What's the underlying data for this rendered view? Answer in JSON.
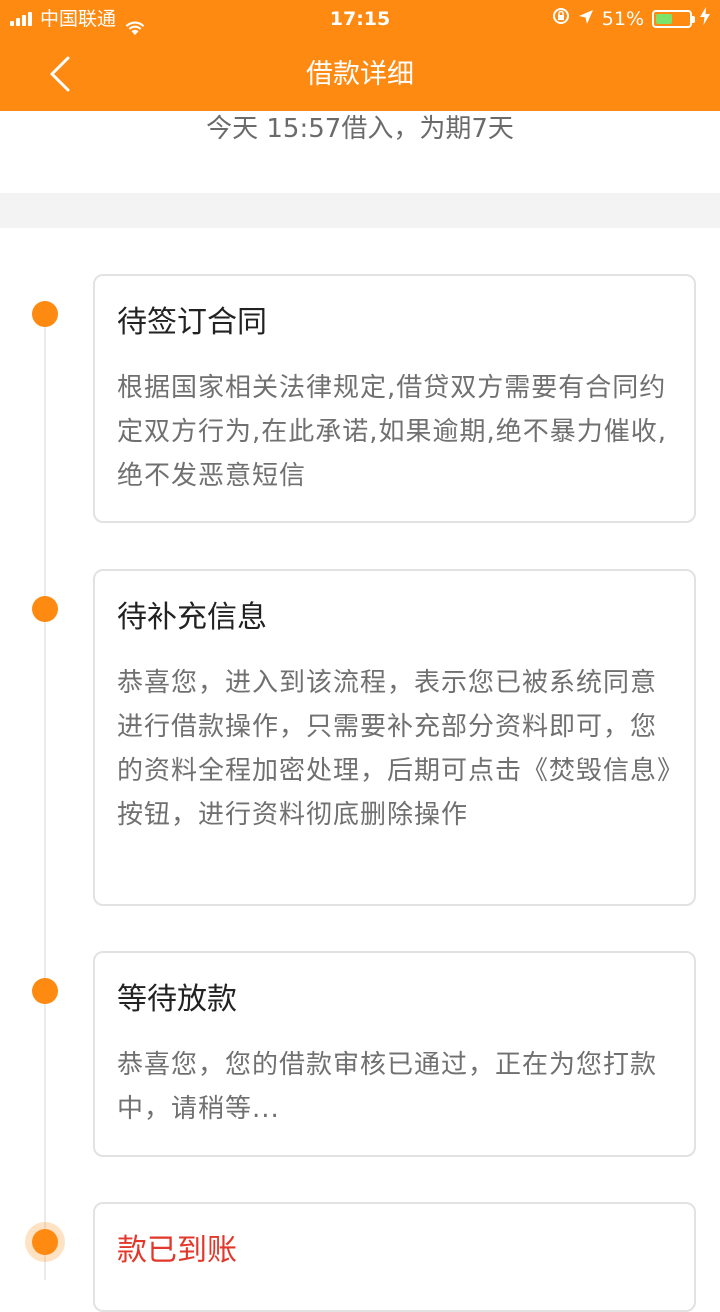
{
  "status_bar": {
    "carrier": "中国联通",
    "time": "17:15",
    "battery": "51%",
    "battery_level": 0.51
  },
  "header": {
    "title": "借款详细"
  },
  "loan": {
    "summary": "今天 15:57借入，为期7天"
  },
  "steps": [
    {
      "title": "待签订合同",
      "desc": "根据国家相关法律规定,借贷双方需要有合同约定双方行为,在此承诺,如果逾期,绝不暴力催收,绝不发恶意短信"
    },
    {
      "title": "待补充信息",
      "desc": "恭喜您，进入到该流程，表示您已被系统同意进行借款操作，只需要补充部分资料即可，您的资料全程加密处理，后期可点击《焚毁信息》按钮，进行资料彻底删除操作"
    },
    {
      "title": "等待放款",
      "desc": "恭喜您，您的借款审核已通过，正在为您打款中，请稍等..."
    },
    {
      "title": "款已到账",
      "desc": ""
    }
  ],
  "colors": {
    "accent": "#fe8a12",
    "current_step": "#e2382b",
    "battery_fill": "#7be36a"
  }
}
